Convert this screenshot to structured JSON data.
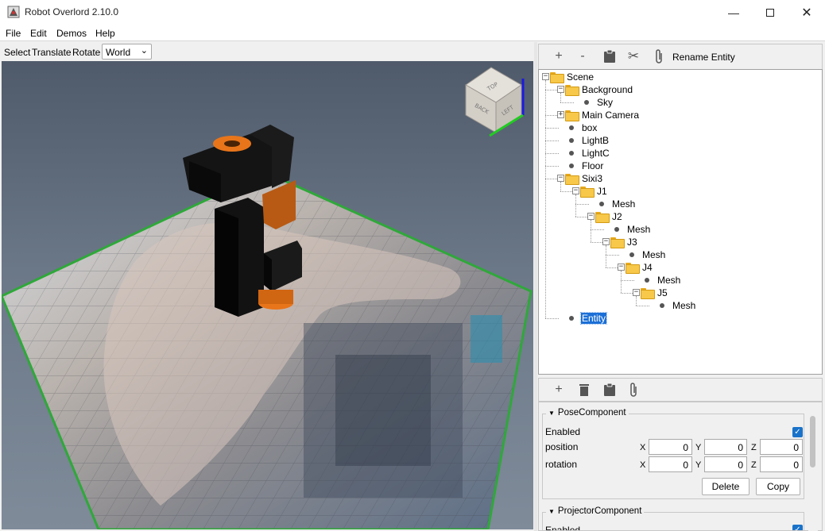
{
  "window": {
    "title": "Robot Overlord 2.10.0",
    "controls": [
      "minimize-icon",
      "maximize-icon",
      "close-icon"
    ]
  },
  "menu": [
    "File",
    "Edit",
    "Demos",
    "Help"
  ],
  "viewport_toolbar": {
    "select": "Select",
    "translate": "Translate",
    "rotate": "Rotate",
    "frame": "World"
  },
  "view_cube": {
    "top": "TOP",
    "back": "BACK",
    "left": "LEFT"
  },
  "entity_toolbar": {
    "icons": [
      "add-icon",
      "remove-icon",
      "paste-icon",
      "cut-icon",
      "attach-icon"
    ],
    "add": "+",
    "remove": "-",
    "rename": "Rename Entity"
  },
  "tree": {
    "nodes": [
      {
        "label": "Scene",
        "kind": "folder",
        "depth": 0,
        "expanded": true
      },
      {
        "label": "Background",
        "kind": "folder",
        "depth": 1,
        "expanded": true
      },
      {
        "label": "Sky",
        "kind": "leaf",
        "depth": 2
      },
      {
        "label": "Main Camera",
        "kind": "folder",
        "depth": 1,
        "expanded": false
      },
      {
        "label": "box",
        "kind": "leaf",
        "depth": 1
      },
      {
        "label": "LightB",
        "kind": "leaf",
        "depth": 1
      },
      {
        "label": "LightC",
        "kind": "leaf",
        "depth": 1
      },
      {
        "label": "Floor",
        "kind": "leaf",
        "depth": 1
      },
      {
        "label": "Sixi3",
        "kind": "folder",
        "depth": 1,
        "expanded": true
      },
      {
        "label": "J1",
        "kind": "folder",
        "depth": 2,
        "expanded": true
      },
      {
        "label": "Mesh",
        "kind": "leaf",
        "depth": 3
      },
      {
        "label": "J2",
        "kind": "folder",
        "depth": 3,
        "expanded": true
      },
      {
        "label": "Mesh",
        "kind": "leaf",
        "depth": 4
      },
      {
        "label": "J3",
        "kind": "folder",
        "depth": 4,
        "expanded": true
      },
      {
        "label": "Mesh",
        "kind": "leaf",
        "depth": 5
      },
      {
        "label": "J4",
        "kind": "folder",
        "depth": 5,
        "expanded": true
      },
      {
        "label": "Mesh",
        "kind": "leaf",
        "depth": 6
      },
      {
        "label": "J5",
        "kind": "folder",
        "depth": 6,
        "expanded": true
      },
      {
        "label": "Mesh",
        "kind": "leaf",
        "depth": 7
      },
      {
        "label": "Entity",
        "kind": "leaf",
        "depth": 1,
        "selected": true
      }
    ]
  },
  "component_toolbar": {
    "icons": [
      "add-icon",
      "trash-icon",
      "paste-icon",
      "attach-icon"
    ],
    "add": "+"
  },
  "pose_component": {
    "title": "PoseComponent",
    "enabled_label": "Enabled",
    "enabled": true,
    "position_label": "position",
    "rotation_label": "rotation",
    "axes": [
      "X",
      "Y",
      "Z"
    ],
    "position": [
      "0",
      "0",
      "0"
    ],
    "rotation": [
      "0",
      "0",
      "0"
    ],
    "delete": "Delete",
    "copy": "Copy"
  },
  "projector_component": {
    "title": "ProjectorComponent",
    "enabled_label": "Enabled"
  },
  "colors": {
    "selection": "#1b6fd6",
    "floor_border": "#2fa83a",
    "robot_accent": "#e8751a",
    "checkbox": "#1a73c9"
  }
}
